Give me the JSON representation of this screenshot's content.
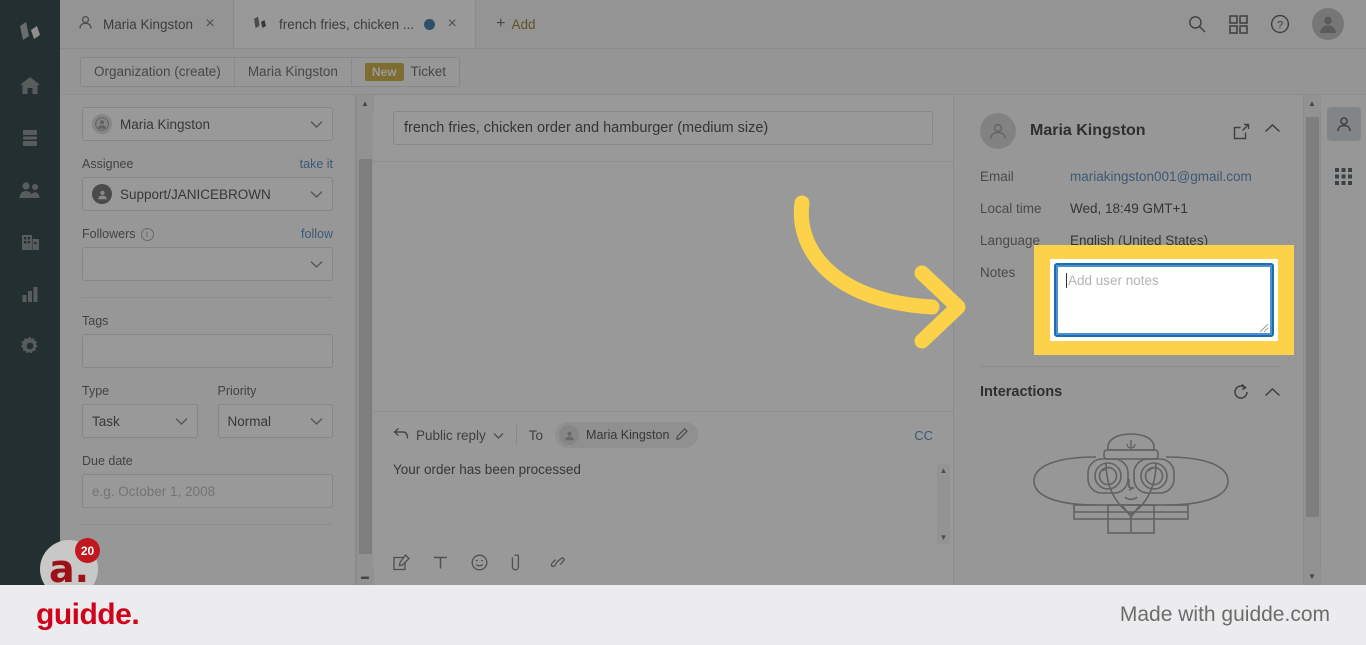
{
  "nav": {
    "items": [
      {
        "name": "logo",
        "icon": "zammad-logo-icon"
      },
      {
        "name": "dashboard",
        "icon": "home-icon"
      },
      {
        "name": "overviews",
        "icon": "overviews-icon"
      },
      {
        "name": "customers",
        "icon": "users-icon"
      },
      {
        "name": "organizations",
        "icon": "building-icon"
      },
      {
        "name": "reporting",
        "icon": "bar-chart-icon"
      },
      {
        "name": "admin",
        "icon": "gear-icon"
      }
    ]
  },
  "tabs": [
    {
      "label": "Maria Kingston",
      "icon": "user-icon",
      "active": false,
      "unread": false,
      "close": "×"
    },
    {
      "label": "french fries, chicken ...",
      "icon": "ticket-icon",
      "active": true,
      "unread": true,
      "close": "×"
    }
  ],
  "add_tab": {
    "label": "Add",
    "plus": "+"
  },
  "topbar_icons": [
    {
      "name": "search-icon"
    },
    {
      "name": "apps-grid-icon"
    },
    {
      "name": "help-icon"
    },
    {
      "name": "user-avatar"
    }
  ],
  "breadcrumb": [
    {
      "label": "Organization (create)"
    },
    {
      "label": "Maria Kingston"
    },
    {
      "label": "Ticket",
      "badge": "New"
    }
  ],
  "form": {
    "customer": {
      "value": "Maria Kingston"
    },
    "assignee": {
      "label": "Assignee",
      "action": "take it",
      "value": "Support/JANICEBROWN"
    },
    "followers": {
      "label": "Followers",
      "action": "follow",
      "value": ""
    },
    "tags": {
      "label": "Tags",
      "value": ""
    },
    "type": {
      "label": "Type",
      "value": "Task"
    },
    "priority": {
      "label": "Priority",
      "value": "Normal"
    },
    "due_date": {
      "label": "Due date",
      "placeholder": "e.g. October 1, 2008",
      "value": ""
    }
  },
  "ticket": {
    "title": "french fries, chicken order and hamburger (medium size)"
  },
  "composer": {
    "reply_type": "Public reply",
    "to_label": "To",
    "to_recipient": "Maria Kingston",
    "cc_label": "CC",
    "body": "Your order has been processed",
    "tools": [
      {
        "name": "signature-icon"
      },
      {
        "name": "text-format-icon"
      },
      {
        "name": "emoji-icon"
      },
      {
        "name": "attachment-icon"
      },
      {
        "name": "link-icon"
      }
    ]
  },
  "customer_panel": {
    "name": "Maria Kingston",
    "fields": [
      {
        "key": "Email",
        "value": "mariakingston001@gmail.com",
        "is_link": true
      },
      {
        "key": "Local time",
        "value": "Wed, 18:49 GMT+1",
        "is_link": false
      },
      {
        "key": "Language",
        "value": "English (United States)",
        "is_link": false
      },
      {
        "key": "Notes",
        "value": "",
        "is_link": false
      }
    ],
    "notes_placeholder": "Add user notes",
    "interactions": {
      "title": "Interactions"
    }
  },
  "right_rail": [
    {
      "name": "customer-tab-icon",
      "active": true
    },
    {
      "name": "apps-tab-icon",
      "active": false
    }
  ],
  "guidde": {
    "badge_count": "20",
    "badge_letter": "a.",
    "brand": "guidde.",
    "made_with": "Made with guidde.com"
  },
  "colors": {
    "highlight": "#fbd24a",
    "focus_border": "#1f6bb0",
    "brand_red": "#d0021b",
    "nav_dark": "#0b2226",
    "badge_gold": "#c9a227",
    "link_blue": "#3e7ab5"
  }
}
